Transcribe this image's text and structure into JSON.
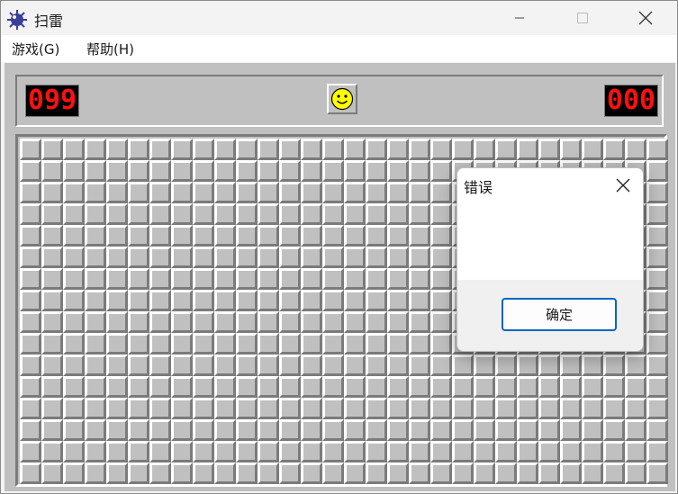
{
  "window": {
    "title": "扫雷",
    "icon": "mine-icon"
  },
  "menu": [
    {
      "label": "游戏(G)"
    },
    {
      "label": "帮助(H)"
    }
  ],
  "game": {
    "mine_counter": "099",
    "timer": "000",
    "face": "smiley-icon",
    "rows": 16,
    "cols": 30
  },
  "dialog": {
    "title": "错误",
    "message": "",
    "ok_label": "确定"
  },
  "colors": {
    "lcd_bg": "#000000",
    "lcd_digits": "#ff1010",
    "board_gray": "#c0c0c0",
    "button_border": "#0067c0"
  }
}
